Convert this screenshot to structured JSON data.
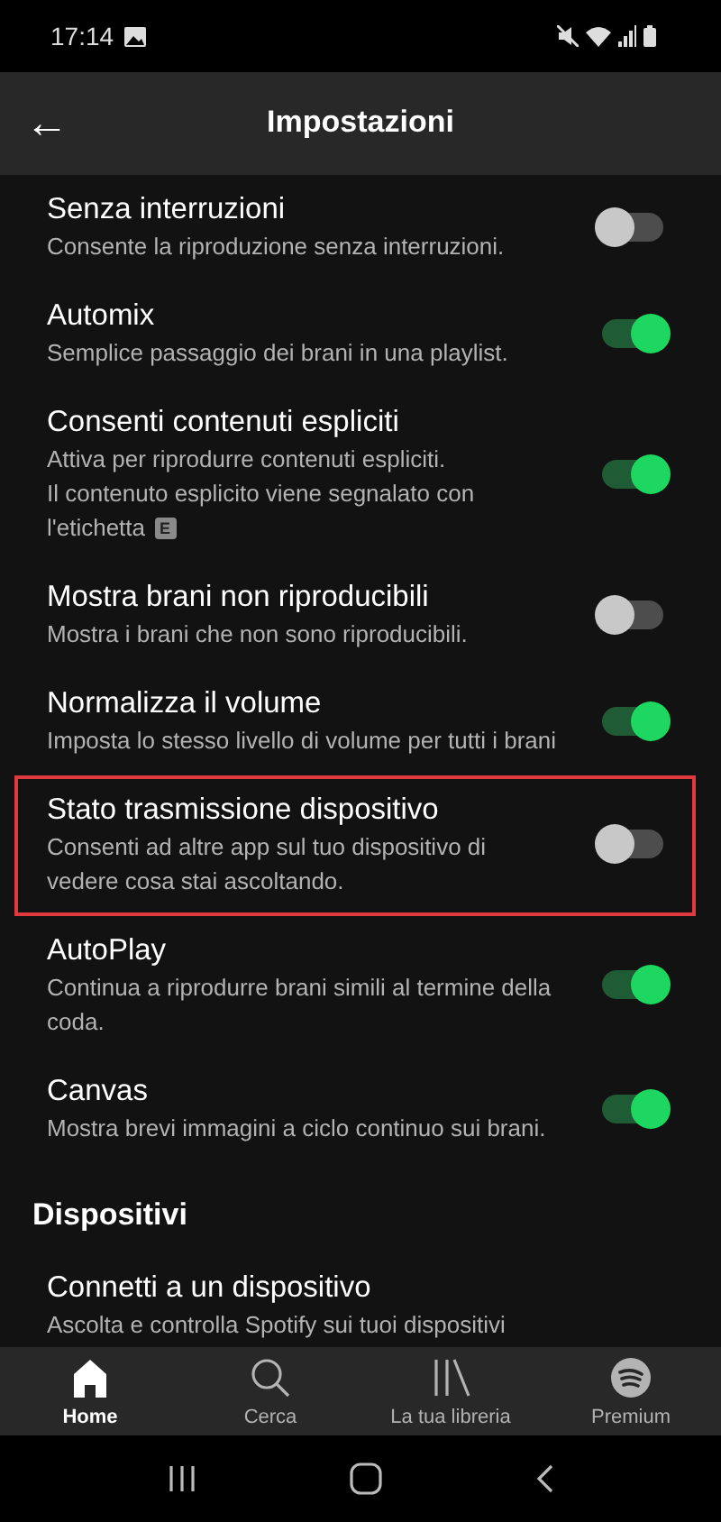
{
  "status_bar": {
    "time": "17:14"
  },
  "header": {
    "back": "←",
    "title": "Impostazioni"
  },
  "settings": [
    {
      "kind": "toggle",
      "title": "Senza interruzioni",
      "lines": [
        "Consente la riproduzione senza interruzioni."
      ],
      "on": false,
      "highlighted": false
    },
    {
      "kind": "toggle",
      "title": "Automix",
      "lines": [
        "Semplice passaggio dei brani in una playlist."
      ],
      "on": true,
      "highlighted": false
    },
    {
      "kind": "toggle",
      "title": "Consenti contenuti espliciti",
      "lines": [
        "Attiva per riprodurre contenuti espliciti.",
        "Il contenuto esplicito viene segnalato con",
        "l'etichetta"
      ],
      "badge": "E",
      "on": true,
      "highlighted": false
    },
    {
      "kind": "toggle",
      "title": "Mostra brani non riproducibili",
      "lines": [
        "Mostra i brani che non sono riproducibili."
      ],
      "on": false,
      "highlighted": false
    },
    {
      "kind": "toggle",
      "title": "Normalizza il volume",
      "lines": [
        "Imposta lo stesso livello di volume per tutti i brani"
      ],
      "on": true,
      "highlighted": false
    },
    {
      "kind": "toggle",
      "title": "Stato trasmissione dispositivo",
      "lines": [
        "Consenti ad altre app sul tuo dispositivo di",
        "vedere cosa stai ascoltando."
      ],
      "on": false,
      "highlighted": true
    },
    {
      "kind": "toggle",
      "title": "AutoPlay",
      "lines": [
        "Continua a riprodurre brani simili al termine della",
        "coda."
      ],
      "on": true,
      "highlighted": false
    },
    {
      "kind": "toggle",
      "title": "Canvas",
      "lines": [
        "Mostra brevi immagini a ciclo continuo sui brani."
      ],
      "on": true,
      "highlighted": false
    },
    {
      "kind": "heading",
      "title": "Dispositivi"
    },
    {
      "kind": "link",
      "title": "Connetti a un dispositivo",
      "lines": [
        "Ascolta e controlla Spotify sui tuoi dispositivi"
      ]
    }
  ],
  "tabs": [
    {
      "label": "Home",
      "selected": true
    },
    {
      "label": "Cerca",
      "selected": false
    },
    {
      "label": "La tua libreria",
      "selected": false
    },
    {
      "label": "Premium",
      "selected": false
    }
  ]
}
